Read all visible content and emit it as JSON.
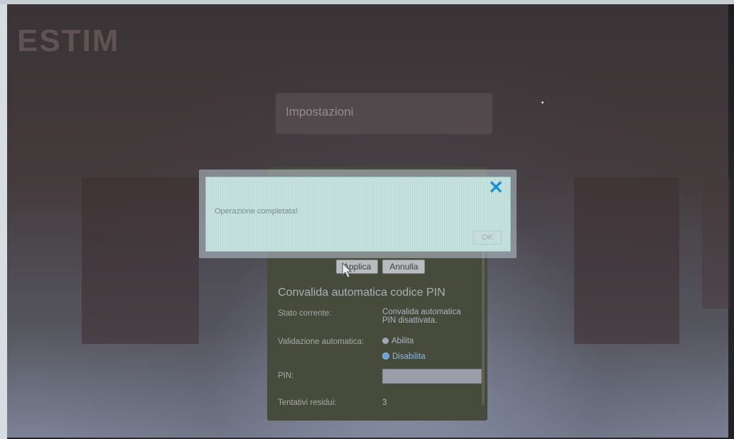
{
  "brand": {
    "text": "ESTIM"
  },
  "menu_card": {
    "title": "Impostazioni"
  },
  "pin_panel": {
    "buttons": {
      "apply": "Applica",
      "cancel": "Annulla"
    },
    "section_title": "Convalida automatica codice PIN",
    "current_state_label": "Stato corrente:",
    "current_state_value_line1": "Convalida automatica",
    "current_state_value_line2": "PIN disattivata.",
    "auto_validation_label": "Validazione automatica:",
    "option_enable": "Abilita",
    "option_disable": "Disabilita",
    "selected_option": "Disabilita",
    "pin_label": "PIN:",
    "pin_value": "",
    "attempts_label": "Tentativi residui:",
    "attempts_value": "3"
  },
  "dialog": {
    "message": "Operazione completata!",
    "ok_label": "OK",
    "close_icon": "close-icon"
  },
  "colors": {
    "accent": "#1f8fd6",
    "dialog_bg": "#c6e2df",
    "panel_bg": "#474b3b"
  }
}
